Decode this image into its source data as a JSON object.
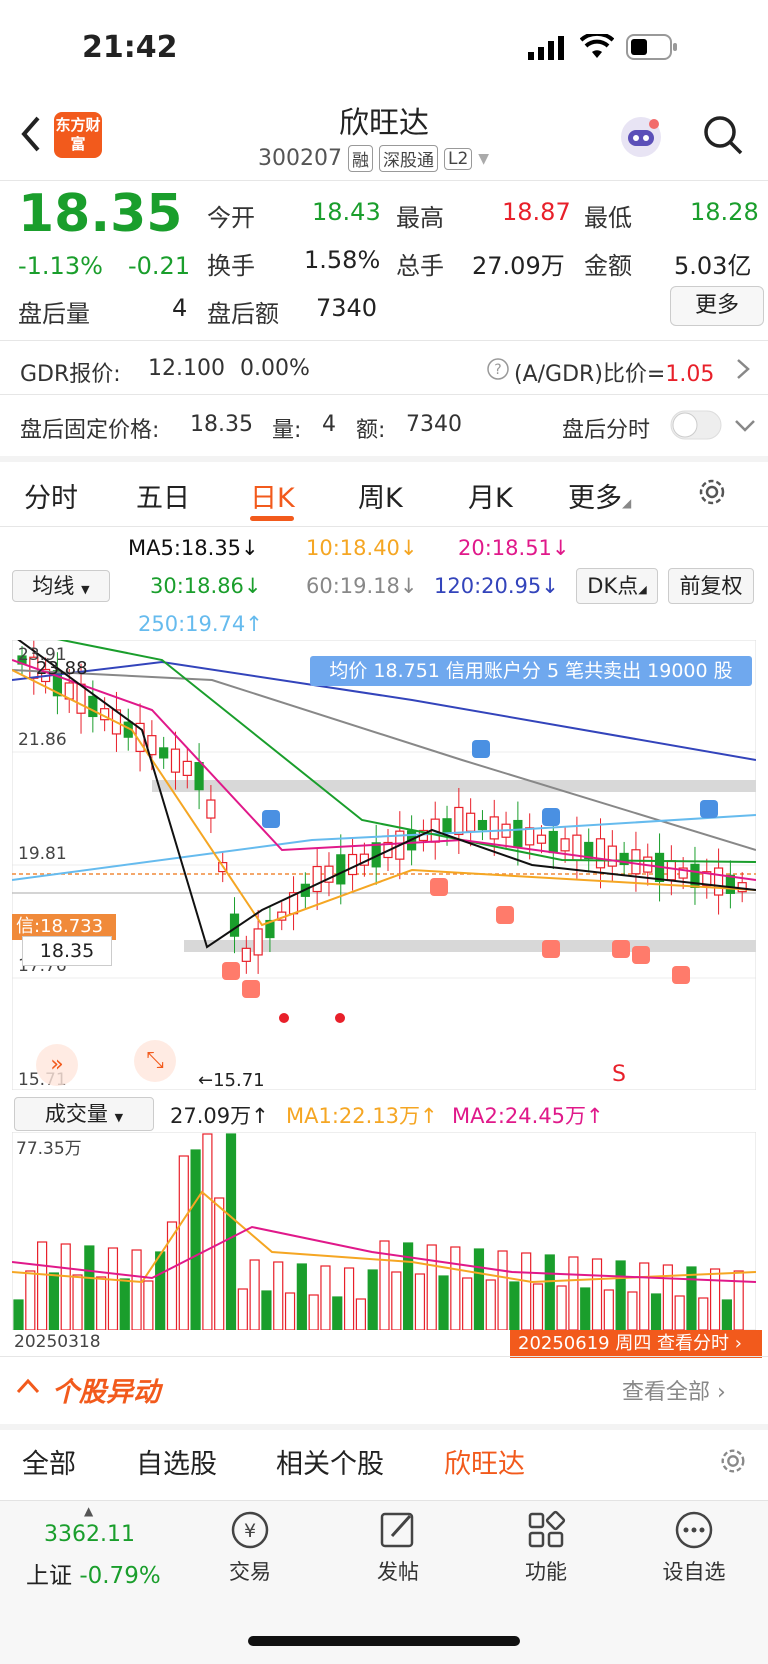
{
  "status": {
    "time": "21:42"
  },
  "header": {
    "logo_text": "东方财富",
    "stock_name": "欣旺达",
    "stock_code": "300207",
    "tags": [
      "融",
      "深股通",
      "L2"
    ]
  },
  "quote": {
    "price": "18.35",
    "change_pct": "-1.13%",
    "change_amt": "-0.21",
    "fields": [
      {
        "label": "今开",
        "value": "18.43",
        "color": "#1a9e2c"
      },
      {
        "label": "最高",
        "value": "18.87",
        "color": "#e8202a"
      },
      {
        "label": "最低",
        "value": "18.28",
        "color": "#1a9e2c"
      },
      {
        "label": "换手",
        "value": "1.58%",
        "color": "#222222"
      },
      {
        "label": "总手",
        "value": "27.09万",
        "color": "#222222"
      },
      {
        "label": "金额",
        "value": "5.03亿",
        "color": "#222222"
      }
    ],
    "after_volume_label": "盘后量",
    "after_volume": "4",
    "after_amount_label": "盘后额",
    "after_amount": "7340",
    "more_label": "更多"
  },
  "gdr": {
    "label": "GDR报价:",
    "price": "12.100",
    "change": "0.00%",
    "ratio_label": "(A/GDR)比价=",
    "ratio": "1.05"
  },
  "after_fixed": {
    "label": "盘后固定价格:",
    "price": "18.35",
    "vol_label": "量:",
    "vol": "4",
    "amt_label": "额:",
    "amt": "7340",
    "toggle_label": "盘后分时"
  },
  "tabs": [
    "分时",
    "五日",
    "日K",
    "周K",
    "月K",
    "更多"
  ],
  "active_tab": "日K",
  "ma": {
    "selector": "均线",
    "ma5": "MA5:18.35↓",
    "ma10": "10:18.40↓",
    "ma20": "20:18.51↓",
    "ma30": "30:18.86↓",
    "ma60": "60:19.18↓",
    "ma120": "120:20.95↓",
    "ma250": "250:19.74↑",
    "dk_label": "DK点",
    "fq_label": "前复权"
  },
  "chart": {
    "banner": "均价 18.751 信用账户分 5 笔共卖出 19000 股",
    "y_labels": [
      "23.91",
      "21.86",
      "19.81",
      "17.76",
      "15.71"
    ],
    "hi_label": "23.88",
    "lo_label": "←15.71",
    "credit_label": "信:18.733",
    "current_label": "18.35",
    "s_mark": "S",
    "colors": {
      "ma5": "#111111",
      "ma10": "#f5a623",
      "ma20": "#e0198a",
      "ma30": "#1a9e2c",
      "ma60": "#888888",
      "ma120": "#3344bb",
      "ma250": "#66bbee"
    }
  },
  "volume": {
    "selector": "成交量",
    "total": "27.09万↑",
    "ma1": "MA1:22.13万↑",
    "ma2": "MA2:24.45万↑",
    "max_label": "77.35万",
    "start_date": "20250318",
    "end_label": "20250619 周四 查看分时"
  },
  "abnormal": {
    "title": "个股异动",
    "view_all": "查看全部"
  },
  "bottom_tabs": [
    "全部",
    "自选股",
    "相关个股",
    "欣旺达"
  ],
  "nav": {
    "index_value": "3362.11",
    "index_name": "上证",
    "index_change": "-0.79%",
    "items": [
      "交易",
      "发帖",
      "功能",
      "设自选"
    ]
  }
}
